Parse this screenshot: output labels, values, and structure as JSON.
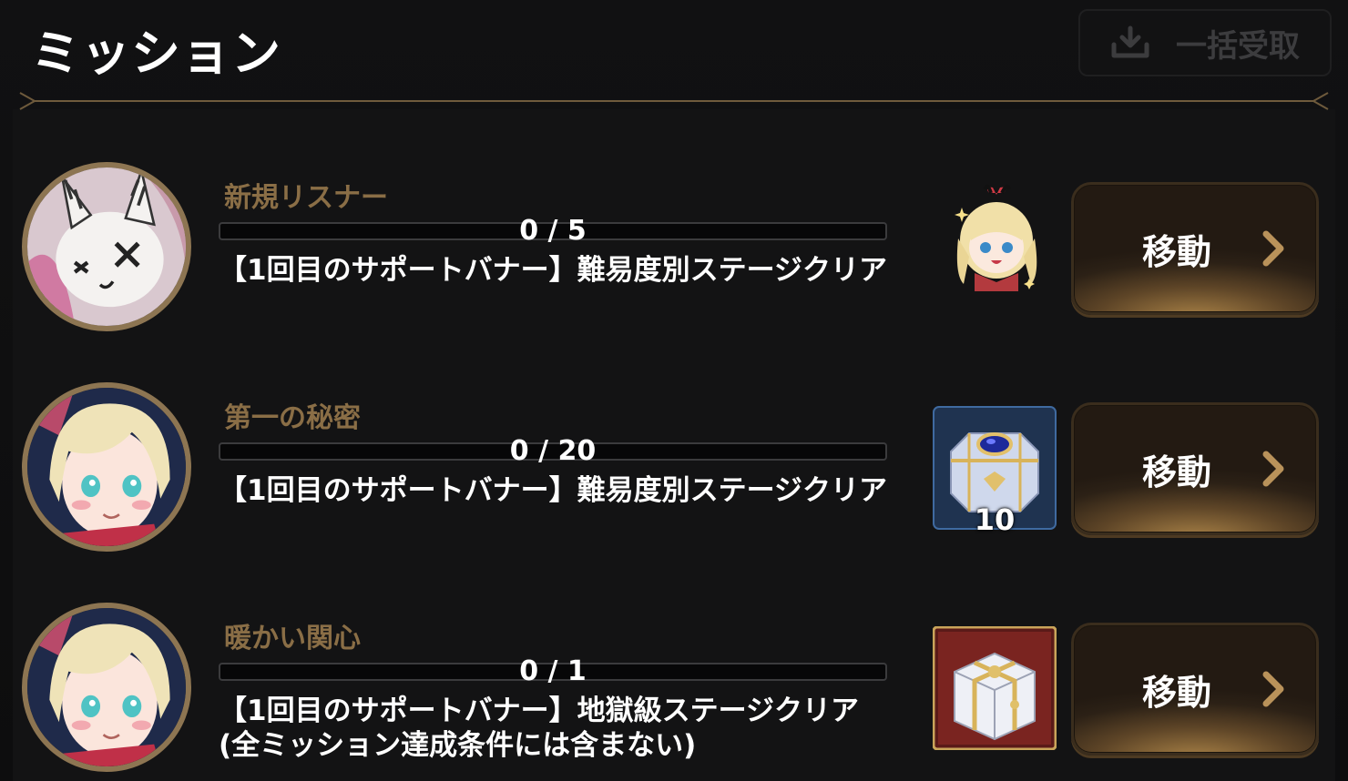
{
  "header": {
    "title": "ミッション",
    "claim_all_label": "一括受取",
    "claim_all_icon": "download-icon"
  },
  "missions": [
    {
      "name": "新規リスナー",
      "progress_text": "0 / 5",
      "progress_fraction": 0,
      "description": "【1回目のサポートバナー】難易度別ステージクリア",
      "reward_icon": "chibi-character-sticker",
      "reward_count": "",
      "button_label": "移動"
    },
    {
      "name": "第一の秘密",
      "progress_text": "0 / 20",
      "progress_fraction": 0,
      "description": "【1回目のサポートバナー】難易度別ステージクリア",
      "reward_icon": "jewel-chest-icon",
      "reward_count": "10",
      "button_label": "移動"
    },
    {
      "name": "暖かい関心",
      "progress_text": "0 / 1",
      "progress_fraction": 0,
      "description": "【1回目のサポートバナー】地獄級ステージクリア(全ミッション達成条件には含まない)",
      "reward_icon": "gift-box-icon",
      "reward_count": "",
      "button_label": "移動"
    }
  ],
  "colors": {
    "accent_gold": "#8a6e46",
    "button_glow": "#a88146",
    "background": "#0c0c0d"
  }
}
